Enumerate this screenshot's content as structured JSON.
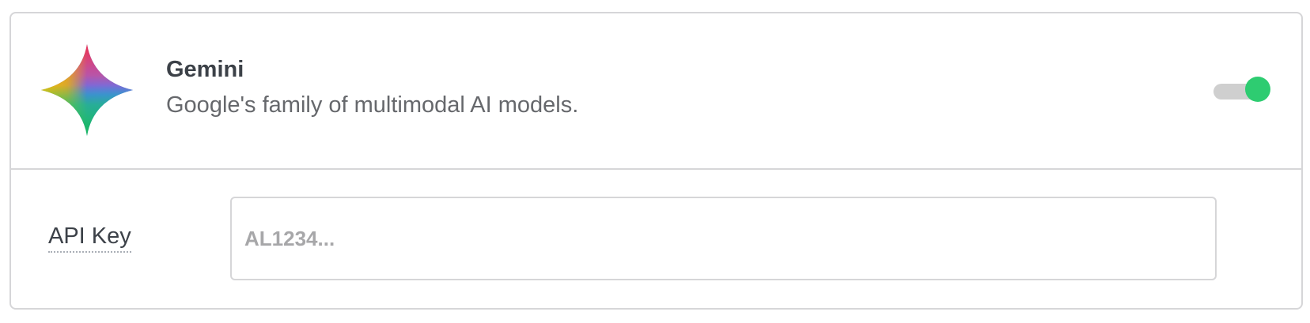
{
  "provider": {
    "name": "Gemini",
    "description": "Google's family of multimodal AI models.",
    "logo_icon": "gemini-sparkle-icon",
    "enabled": true,
    "toggle_color": "#2ecc71"
  },
  "api_key": {
    "label": "API Key",
    "placeholder": "AL1234...",
    "value": ""
  }
}
